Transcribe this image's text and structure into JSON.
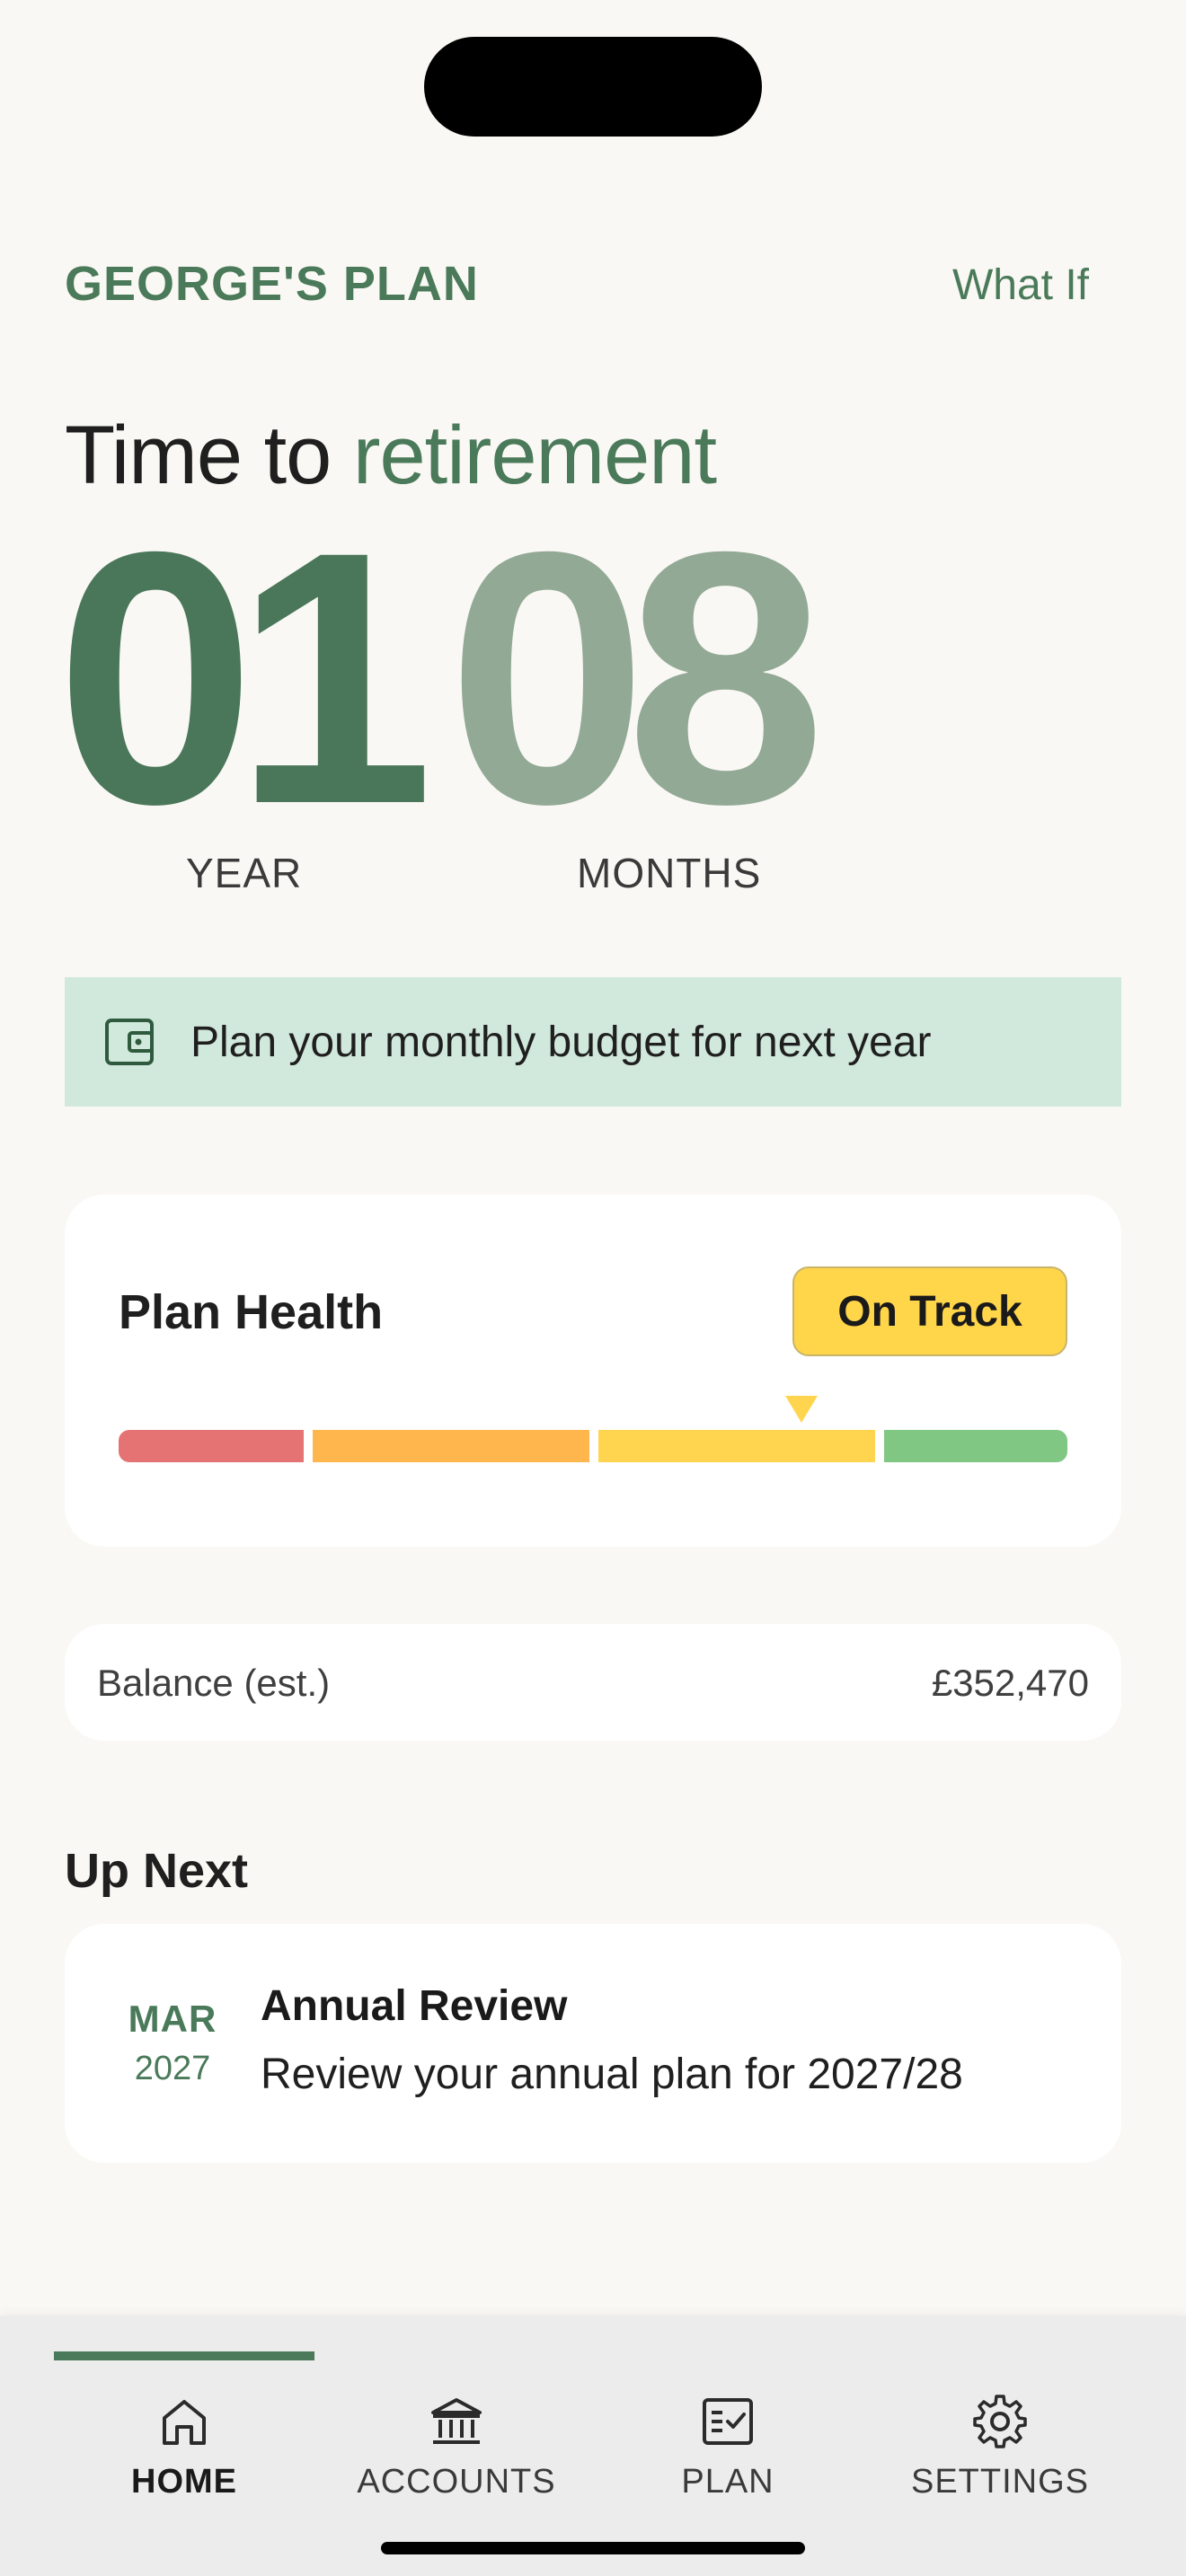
{
  "header": {
    "title": "GEORGE'S PLAN",
    "what_if": "What If"
  },
  "countdown": {
    "heading_prefix": "Time to",
    "heading_accent": "retirement",
    "years": "01",
    "months": "08",
    "years_label": "YEAR",
    "months_label": "MONTHS"
  },
  "banner": {
    "icon": "wallet-icon",
    "text": "Plan your monthly budget for next year"
  },
  "plan_health": {
    "title": "Plan Health",
    "status": "On Track",
    "level": 0.72,
    "segments": [
      {
        "name": "poor",
        "color": "#e57373"
      },
      {
        "name": "fair",
        "color": "#ffb74d"
      },
      {
        "name": "good",
        "color": "#ffd54f"
      },
      {
        "name": "great",
        "color": "#81c784"
      }
    ]
  },
  "balance": {
    "label": "Balance (est.)",
    "value": "£352,470"
  },
  "up_next": {
    "title": "Up Next",
    "item": {
      "month": "MAR",
      "year": "2027",
      "title": "Annual Review",
      "description": "Review your annual plan for 2027/28"
    }
  },
  "tabs": [
    {
      "label": "HOME",
      "icon": "home-icon",
      "active": true
    },
    {
      "label": "ACCOUNTS",
      "icon": "bank-icon",
      "active": false
    },
    {
      "label": "PLAN",
      "icon": "checklist-icon",
      "active": false
    },
    {
      "label": "SETTINGS",
      "icon": "gear-icon",
      "active": false
    }
  ],
  "colors": {
    "accent": "#4a7a59",
    "accent_light": "#92a995",
    "banner_bg": "#d1e8dc",
    "status_yellow": "#ffd54a"
  }
}
